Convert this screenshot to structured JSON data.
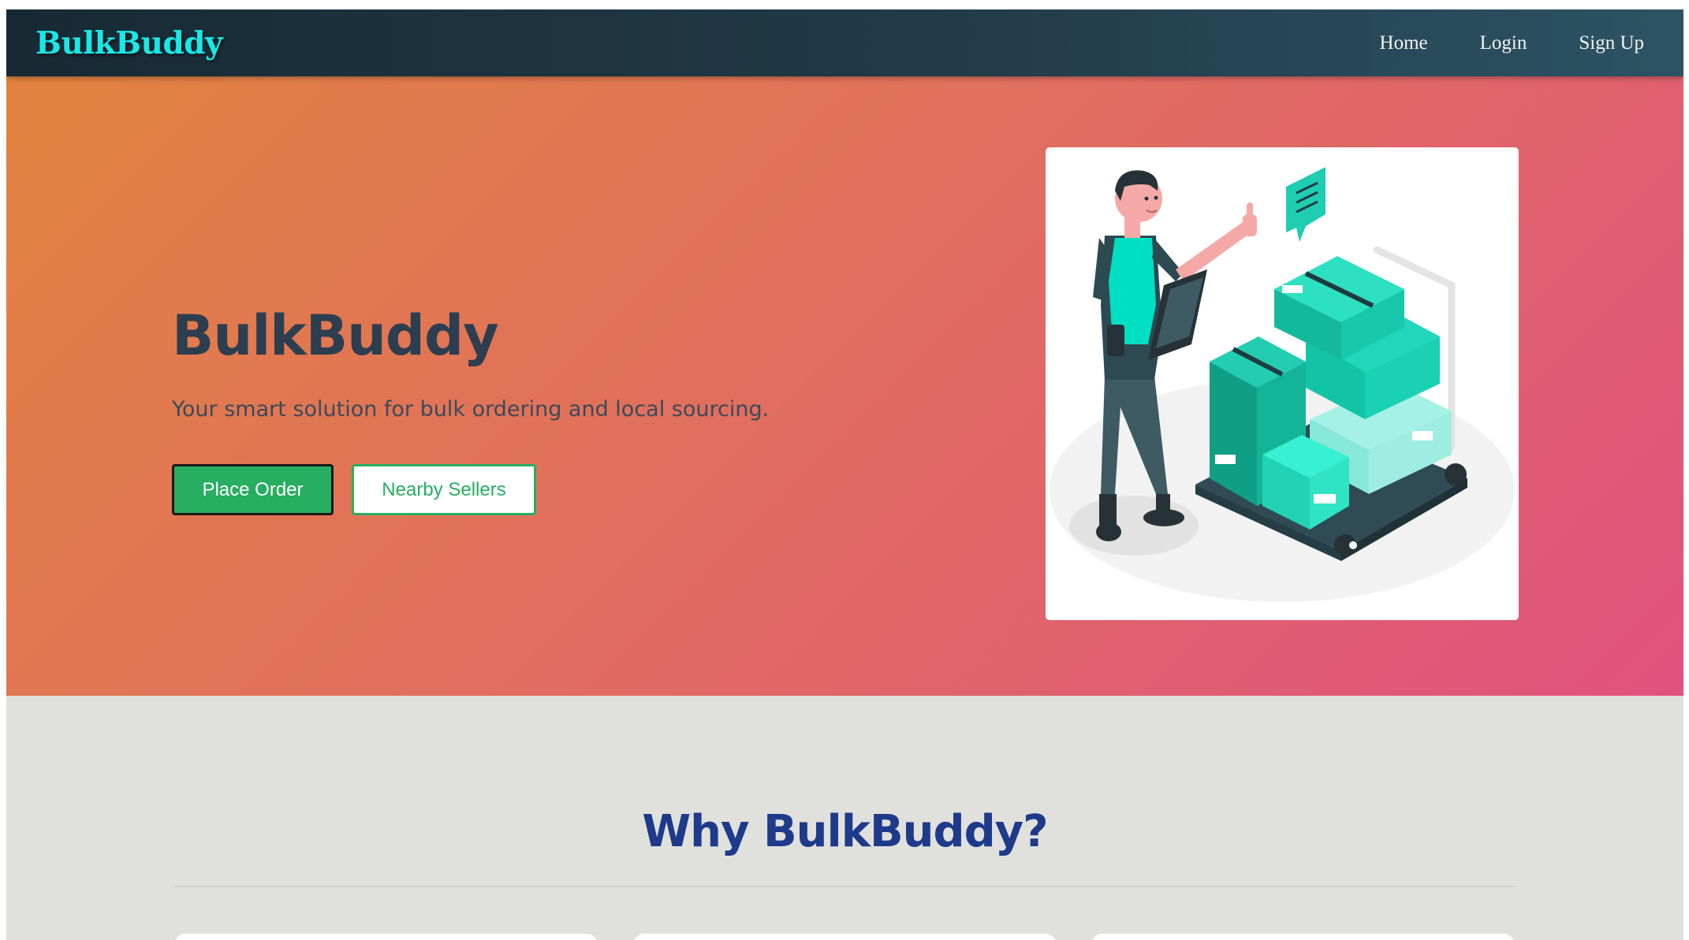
{
  "navbar": {
    "brand": "BulkBuddy",
    "links": [
      {
        "label": "Home"
      },
      {
        "label": "Login"
      },
      {
        "label": "Sign Up"
      }
    ]
  },
  "hero": {
    "title": "BulkBuddy",
    "subtitle": "Your smart solution for bulk ordering and local sourcing.",
    "primary_button": "Place Order",
    "secondary_button": "Nearby Sellers",
    "illustration": "warehouse-worker-with-boxes-illustration"
  },
  "features": {
    "title": "Why BulkBuddy?",
    "cards_visible": 3
  },
  "colors": {
    "brand": "#19e8e8",
    "primary": "#27ae60",
    "heading_dark": "#2c3e50",
    "features_heading": "#1e3a8a",
    "hero_gradient": [
      "#e1833f",
      "#e16f5e",
      "#e0527f"
    ],
    "navbar": [
      "#172a34",
      "#2c5364"
    ]
  }
}
